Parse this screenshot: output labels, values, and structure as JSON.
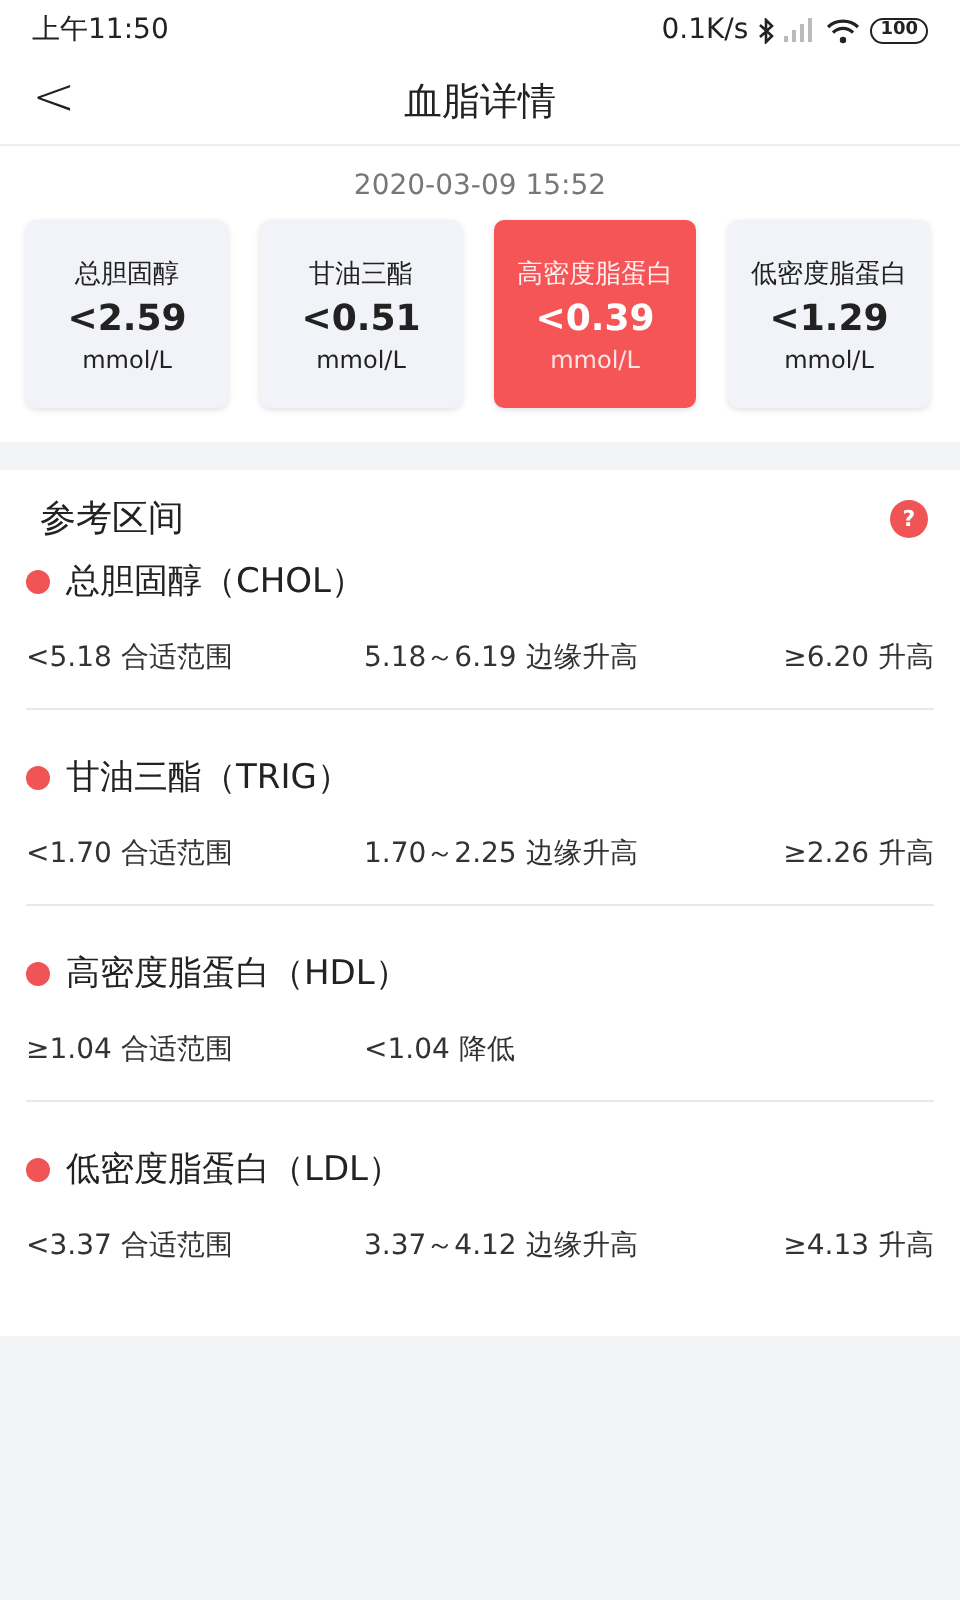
{
  "status_bar": {
    "time": "上午11:50",
    "speed": "0.1K/s",
    "battery": "100"
  },
  "header": {
    "back": "<",
    "title": "血脂详情"
  },
  "date": "2020-03-09 15:52",
  "cards": [
    {
      "name": "总胆固醇",
      "value": "<2.59",
      "unit": "mmol/L",
      "selected": false
    },
    {
      "name": "甘油三酯",
      "value": "<0.51",
      "unit": "mmol/L",
      "selected": false
    },
    {
      "name": "高密度脂蛋白",
      "value": "<0.39",
      "unit": "mmol/L",
      "selected": true
    },
    {
      "name": "低密度脂蛋白",
      "value": "<1.29",
      "unit": "mmol/L",
      "selected": false
    }
  ],
  "reference": {
    "title": "参考区间",
    "help": "?",
    "groups": [
      {
        "name": "总胆固醇（CHOL）",
        "ranges": [
          "<5.18 合适范围",
          "5.18～6.19 边缘升高",
          "≥6.20 升高"
        ]
      },
      {
        "name": "甘油三酯（TRIG）",
        "ranges": [
          "<1.70 合适范围",
          "1.70～2.25 边缘升高",
          "≥2.26 升高"
        ]
      },
      {
        "name": "高密度脂蛋白（HDL）",
        "ranges": [
          "≥1.04 合适范围",
          "<1.04 降低"
        ]
      },
      {
        "name": "低密度脂蛋白（LDL）",
        "ranges": [
          "<3.37 合适范围",
          "3.37～4.12 边缘升高",
          "≥4.13 升高"
        ]
      }
    ]
  }
}
